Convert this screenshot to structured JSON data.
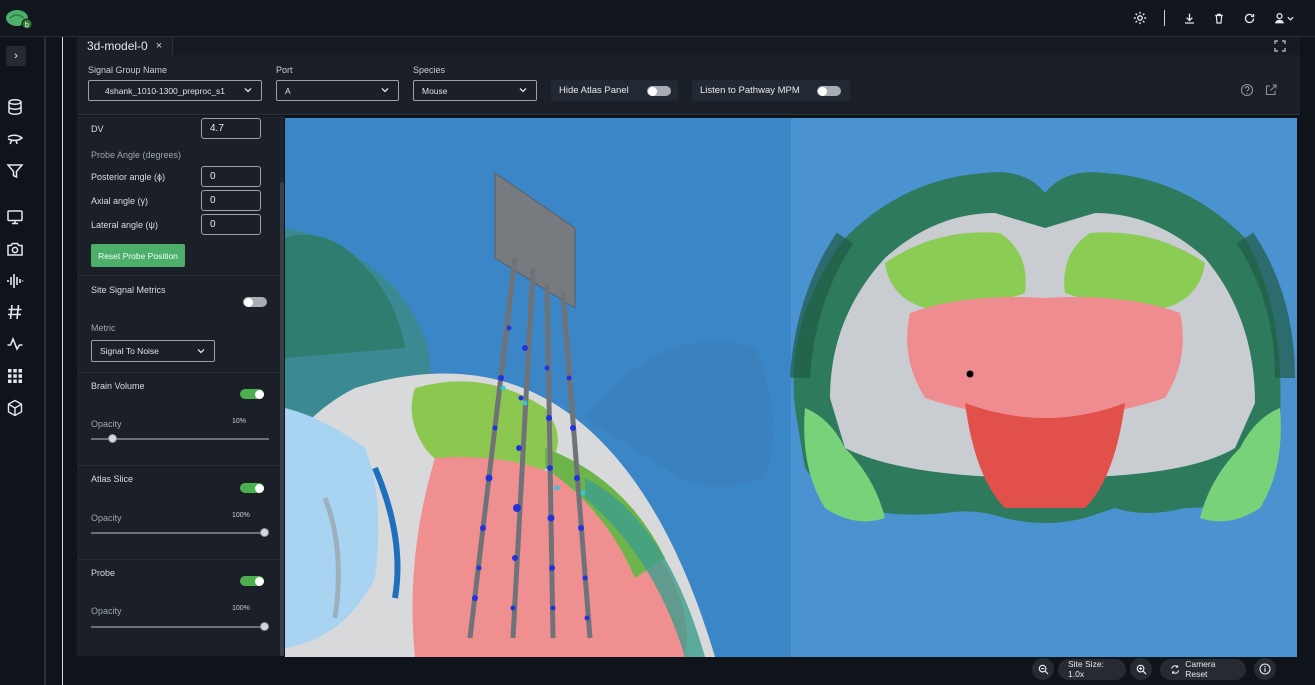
{
  "app": {
    "tab_label": "3d-model-0",
    "tab_close": "×"
  },
  "topbar": {
    "icons": [
      "settings-icon",
      "download-icon",
      "trash-icon",
      "refresh-icon",
      "user-icon",
      "chevron-down-icon"
    ]
  },
  "rail": {
    "toggle_glyph": "›",
    "icons": [
      "database-icon",
      "brain-icon",
      "filter-icon",
      "monitor-icon",
      "camera-icon",
      "waveform-icon",
      "hash-icon",
      "activity-icon",
      "grid-icon",
      "cube-icon"
    ]
  },
  "controls": {
    "signal_group": {
      "label": "Signal Group Name",
      "value": "4shank_1010-1300_preproc_s1"
    },
    "port": {
      "label": "Port",
      "value": "A"
    },
    "species": {
      "label": "Species",
      "value": "Mouse"
    },
    "hide_atlas": {
      "label": "Hide Atlas Panel",
      "on": false
    },
    "listen_pathway": {
      "label": "Listen to Pathway MPM",
      "on": false
    }
  },
  "panel": {
    "dv": {
      "label": "DV",
      "value": "4.7"
    },
    "probe_angle_heading": "Probe Angle (degrees)",
    "posterior": {
      "label": "Posterior angle (ϕ)",
      "value": "0"
    },
    "axial": {
      "label": "Axial angle (γ)",
      "value": "0"
    },
    "lateral": {
      "label": "Lateral angle (ψ)",
      "value": "0"
    },
    "reset_button": "Reset Probe Position",
    "site_signal_metrics": {
      "label": "Site Signal Metrics",
      "on": false
    },
    "metric": {
      "label": "Metric",
      "value": "Signal To Noise"
    },
    "brain_volume": {
      "label": "Brain Volume",
      "on": true,
      "opacity_label": "Opacity",
      "opacity_text": "10%",
      "opacity": 0.1
    },
    "atlas_slice": {
      "label": "Atlas Slice",
      "on": true,
      "opacity_label": "Opacity",
      "opacity_text": "100%",
      "opacity": 1.0
    },
    "probe": {
      "label": "Probe",
      "on": true,
      "opacity_label": "Opacity",
      "opacity_text": "100%",
      "opacity": 1.0
    }
  },
  "bottombar": {
    "site_size": "Site Size: 1.0x",
    "camera_reset": "Camera Reset"
  },
  "colors": {
    "accent_green": "#4caf50",
    "viewport_blue": "#3c8bcc"
  }
}
